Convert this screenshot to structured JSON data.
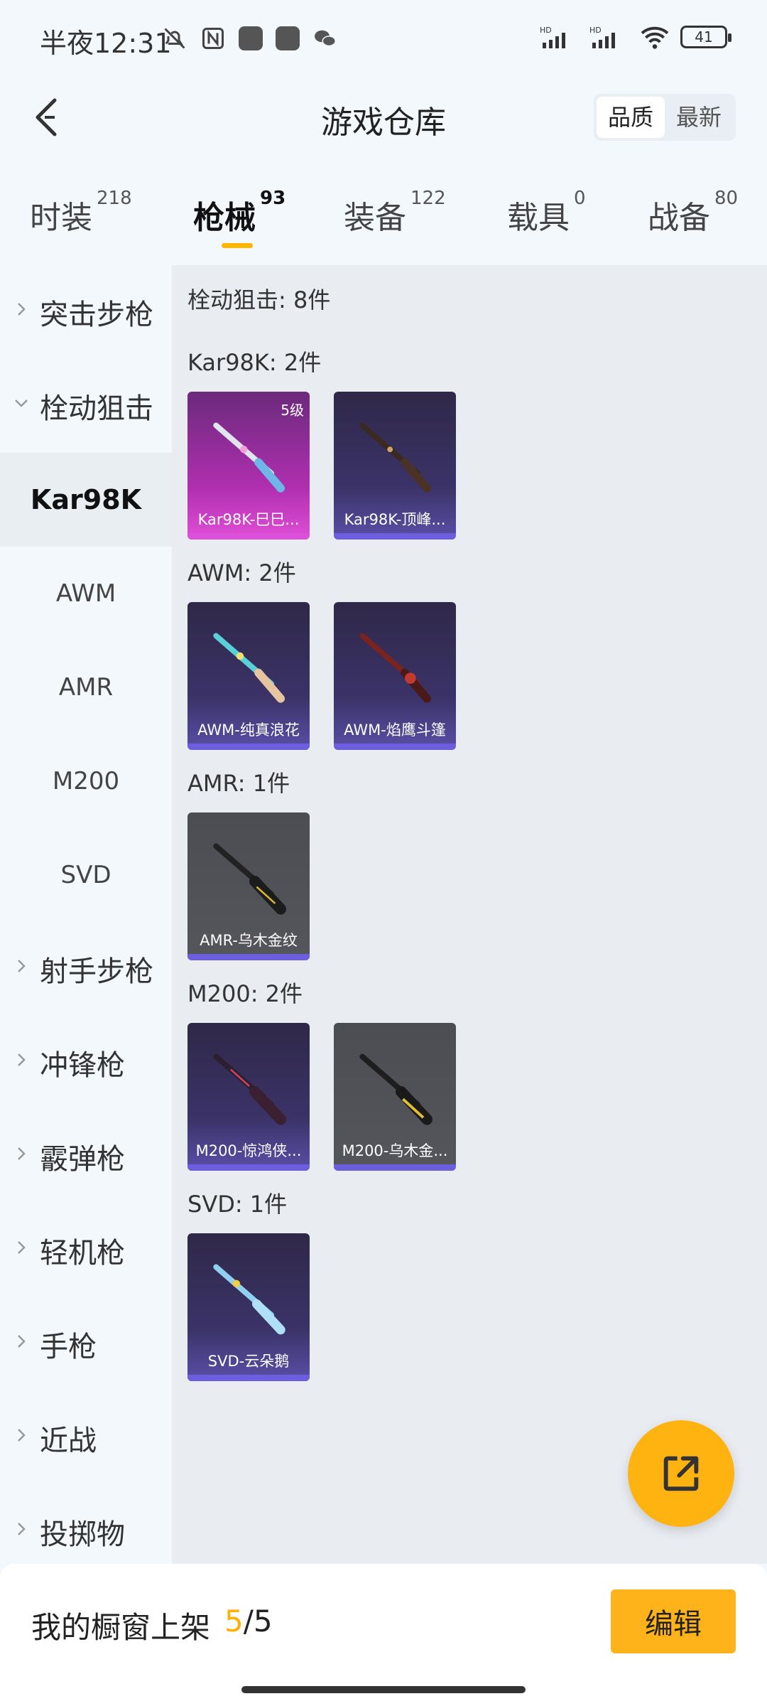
{
  "status": {
    "time": "半夜12:31",
    "battery": "41"
  },
  "header": {
    "title": "游戏仓库",
    "sort": [
      "品质",
      "最新"
    ]
  },
  "tabs": [
    {
      "label": "时装",
      "count": "218"
    },
    {
      "label": "枪械",
      "count": "93"
    },
    {
      "label": "装备",
      "count": "122"
    },
    {
      "label": "载具",
      "count": "0"
    },
    {
      "label": "战备",
      "count": "80"
    }
  ],
  "sidebar": {
    "categories": {
      "assault": "突击步枪",
      "bolt": "栓动狙击",
      "marksman": "射手步枪",
      "smg": "冲锋枪",
      "shotgun": "霰弹枪",
      "lmg": "轻机枪",
      "pistol": "手枪",
      "melee": "近战",
      "throwable": "投掷物"
    },
    "subs": [
      "Kar98K",
      "AWM",
      "AMR",
      "M200",
      "SVD"
    ]
  },
  "main": {
    "summary": "栓动狙击: 8件",
    "groups": [
      {
        "header": "Kar98K: 2件",
        "items": [
          {
            "name": "Kar98K-巳巳...",
            "level": "5级"
          },
          {
            "name": "Kar98K-顶峰..."
          }
        ]
      },
      {
        "header": "AWM: 2件",
        "items": [
          {
            "name": "AWM-纯真浪花"
          },
          {
            "name": "AWM-焰鹰斗篷"
          }
        ]
      },
      {
        "header": "AMR: 1件",
        "items": [
          {
            "name": "AMR-乌木金纹"
          }
        ]
      },
      {
        "header": "M200: 2件",
        "items": [
          {
            "name": "M200-惊鸿侠..."
          },
          {
            "name": "M200-乌木金..."
          }
        ]
      },
      {
        "header": "SVD: 1件",
        "items": [
          {
            "name": "SVD-云朵鹅"
          }
        ]
      }
    ]
  },
  "bottom": {
    "label": "我的橱窗上架",
    "current": "5",
    "total": "/5",
    "edit": "编辑"
  },
  "colors": {
    "accent": "#ffb310",
    "legendary": "#dc4fd9",
    "epic": "#6b5fe0"
  }
}
